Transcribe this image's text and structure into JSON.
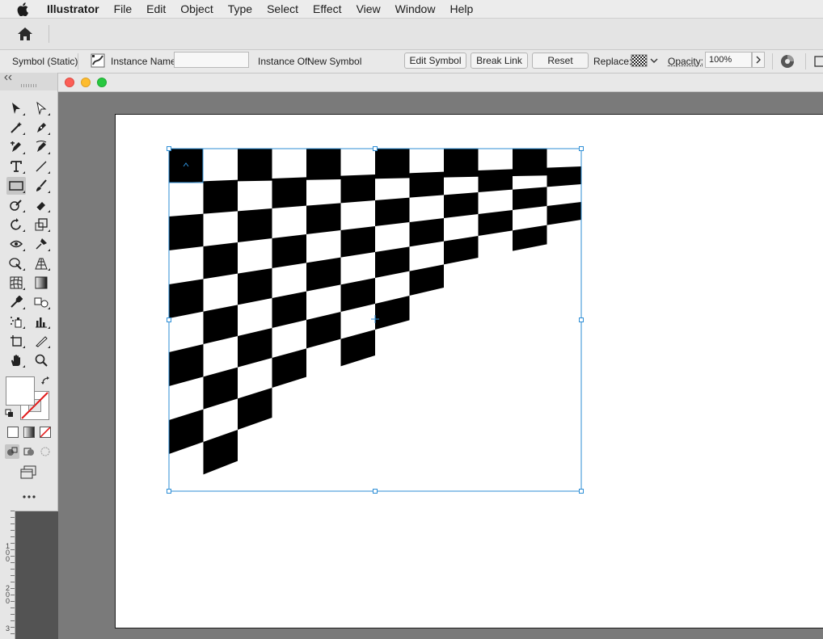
{
  "menubar": {
    "app": "Illustrator",
    "items": [
      "File",
      "Edit",
      "Object",
      "Type",
      "Select",
      "Effect",
      "View",
      "Window",
      "Help"
    ]
  },
  "control_bar": {
    "selection_type": "Symbol (Static)",
    "instance_name_label": "Instance Name:",
    "instance_name_value": "",
    "instance_of_label": "Instance Of:",
    "instance_of_value": "New Symbol",
    "edit_symbol": "Edit Symbol",
    "break_link": "Break Link",
    "reset": "Reset",
    "replace_label": "Replace:",
    "opacity_label": "Opacity:",
    "opacity_value": "100%"
  },
  "ruler_labels": [
    "1\n0\n0",
    "2\n0\n0",
    "3"
  ],
  "colors": {
    "selection": "#2d8ed6",
    "canvas": "#7a7a7a",
    "artboard": "#ffffff"
  },
  "artwork": {
    "type": "distorted checkerboard",
    "columns": 12,
    "rows": 10
  },
  "icons": {
    "home": "home-icon",
    "more_tools": "more-tools-icon"
  }
}
